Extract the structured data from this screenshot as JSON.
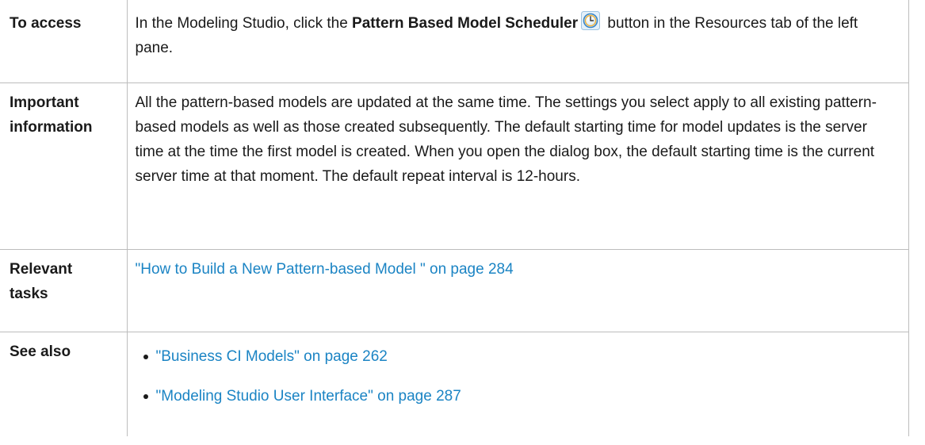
{
  "rows": {
    "access": {
      "label": "To access",
      "text_before_bold": "In the Modeling Studio, click the ",
      "bold_text": "Pattern Based Model Scheduler",
      "icon": "clock-scheduler-icon",
      "text_after_icon": " button in the Resources tab of the left pane."
    },
    "important": {
      "label_line1": "Important",
      "label_line2": "information",
      "text": "All the pattern-based models are updated at the same time. The settings you select apply to all existing pattern-based models as well as those created subsequently. The default starting time for model updates is the server time at the time the first model is created. When you open the dialog box, the default starting time is the current server time at that moment. The default repeat interval is 12-hours."
    },
    "tasks": {
      "label_line1": "Relevant",
      "label_line2": "tasks",
      "link": "\"How to Build a New Pattern-based Model \" on page 284"
    },
    "see_also": {
      "label": "See also",
      "links": [
        "\"Business CI Models\" on page 262",
        "\"Modeling Studio User Interface\" on page 287"
      ]
    }
  },
  "colors": {
    "link": "#1b84c4",
    "border": "#bdbdbd",
    "text": "#1a1a1a"
  }
}
